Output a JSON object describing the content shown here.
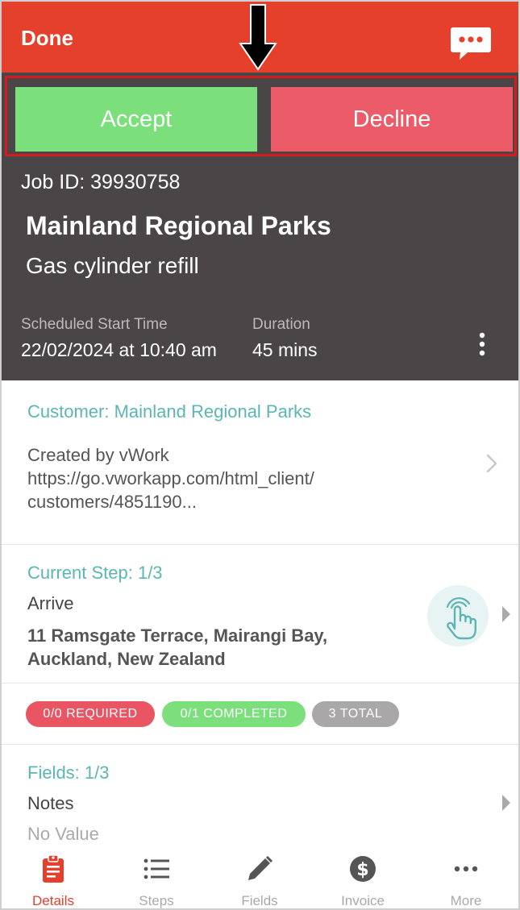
{
  "navbar": {
    "done_label": "Done",
    "chat_icon": "chat-bubble-icon",
    "bg": "#e5402c"
  },
  "actions": {
    "accept_label": "Accept",
    "decline_label": "Decline",
    "accept_color": "#7be07b",
    "decline_color": "#ec5b68"
  },
  "job": {
    "id_text": "Job ID: 39930758",
    "title": "Mainland Regional Parks",
    "subtitle": "Gas cylinder refill",
    "scheduled_label": "Scheduled Start Time",
    "scheduled_value": "22/02/2024 at 10:40 am",
    "duration_label": "Duration",
    "duration_value": "45 mins"
  },
  "customer": {
    "title": "Customer: Mainland Regional Parks",
    "line1": "Created by vWork",
    "line2": "https://go.vworkapp.com/html_client/",
    "line3": "customers/4851190..."
  },
  "step": {
    "title": "Current Step: 1/3",
    "name": "Arrive",
    "address_line1": "11 Ramsgate Terrace, Mairangi Bay,",
    "address_line2": "Auckland, New Zealand"
  },
  "badges": {
    "required": "0/0 REQUIRED",
    "completed": "0/1 COMPLETED",
    "total": "3 TOTAL"
  },
  "fields": {
    "title": "Fields: 1/3",
    "name": "Notes",
    "value": "No Value"
  },
  "tabs": [
    {
      "label": "Details",
      "icon": "clipboard-icon",
      "active": true
    },
    {
      "label": "Steps",
      "icon": "list-icon",
      "active": false
    },
    {
      "label": "Fields",
      "icon": "pencil-icon",
      "active": false
    },
    {
      "label": "Invoice",
      "icon": "dollar-icon",
      "active": false
    },
    {
      "label": "More",
      "icon": "more-dots-icon",
      "active": false
    }
  ],
  "colors": {
    "teal": "#5bb6b3",
    "header_bg": "#4a4648",
    "highlight": "#d51b1b"
  }
}
